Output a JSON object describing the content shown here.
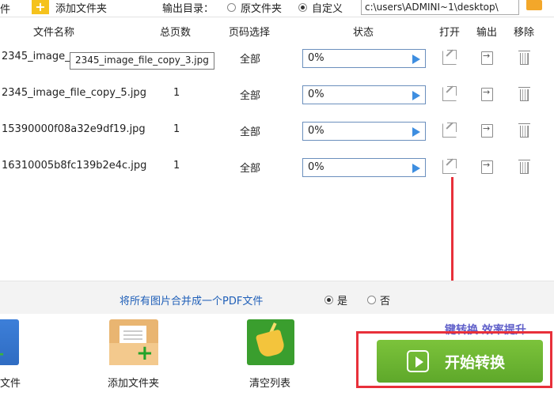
{
  "toolbar": {
    "file_label": "件",
    "add_folder_label": "添加文件夹",
    "output_dir_label": "输出目录：",
    "option_source": "原文件夹",
    "option_custom": "自定义",
    "output_path": "c:\\users\\ADMINI~1\\desktop\\"
  },
  "columns": {
    "name": "文件名称",
    "pages": "总页数",
    "range": "页码选择",
    "status": "状态",
    "open": "打开",
    "export": "输出",
    "remove": "移除"
  },
  "rows": [
    {
      "name": "2345_image_",
      "pages": "",
      "range": "全部",
      "progress": "0%"
    },
    {
      "name": "2345_image_file_copy_5.jpg",
      "pages": "1",
      "range": "全部",
      "progress": "0%"
    },
    {
      "name": "15390000f08a32e9df19.jpg",
      "pages": "1",
      "range": "全部",
      "progress": "0%"
    },
    {
      "name": "16310005b8fc139b2e4c.jpg",
      "pages": "1",
      "range": "全部",
      "progress": "0%"
    }
  ],
  "tooltip": "2345_image_file_copy_3.jpg",
  "merge": {
    "text": "将所有图片合并成一个PDF文件",
    "yes": "是",
    "no": "否"
  },
  "bottom": {
    "add_file_label": "文件",
    "add_folder_label": "添加文件夹",
    "clear_label": "清空列表",
    "promo": "键转换  效率提升",
    "start_label": "开始转换"
  },
  "colors": {
    "start_button": "#6cb632",
    "highlight": "#e8303a",
    "merge_link": "#1f5fb8",
    "promo": "#5f5fc9"
  }
}
